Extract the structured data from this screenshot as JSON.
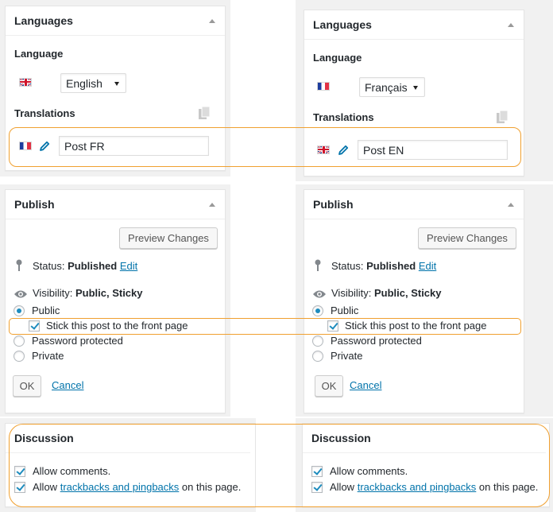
{
  "languages_panel": {
    "title": "Languages",
    "language_label": "Language",
    "translations_label": "Translations",
    "left": {
      "language_flag": "flag-gb-icon",
      "language_value": "English",
      "translation_flag": "flag-fr-icon",
      "translation_value": "Post FR"
    },
    "right": {
      "language_flag": "flag-fr-icon",
      "language_value": "Français",
      "translation_flag": "flag-gb-icon",
      "translation_value": "Post EN"
    }
  },
  "publish_panel": {
    "title": "Publish",
    "preview_button": "Preview Changes",
    "status_label": "Status:",
    "status_value": "Published",
    "status_edit": "Edit",
    "visibility_label": "Visibility:",
    "visibility_value": "Public, Sticky",
    "options": {
      "public": "Public",
      "sticky": "Stick this post to the front page",
      "password": "Password protected",
      "private": "Private"
    },
    "ok_button": "OK",
    "cancel_link": "Cancel"
  },
  "discussion_panel": {
    "title": "Discussion",
    "allow_comments": "Allow comments.",
    "allow_prefix": "Allow",
    "trackbacks_link": "trackbacks and pingbacks",
    "allow_suffix": "on this page."
  },
  "colors": {
    "highlight": "#f0a030",
    "link": "#0073aa",
    "check": "#1e8cbe"
  }
}
